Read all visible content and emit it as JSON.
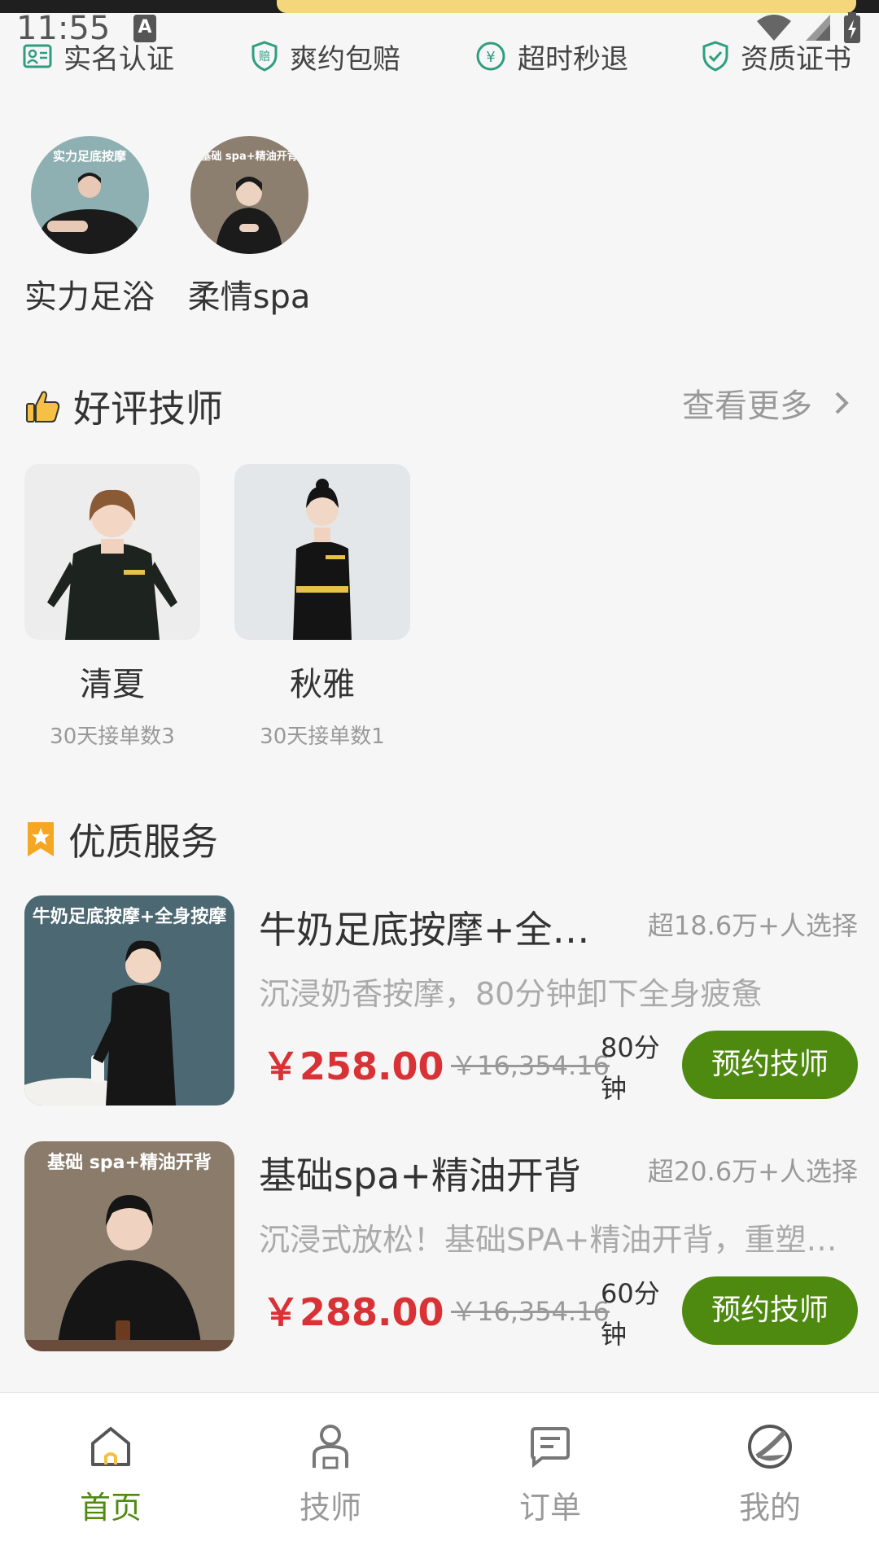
{
  "status_bar": {
    "time": "11:55",
    "notification_letter": "A"
  },
  "guarantees": [
    {
      "label": "实名认证",
      "icon": "id-card-icon"
    },
    {
      "label": "爽约包赔",
      "icon": "shield-compensation-icon",
      "badge": "赔"
    },
    {
      "label": "超时秒退",
      "icon": "yen-refund-icon",
      "badge": "¥"
    },
    {
      "label": "资质证书",
      "icon": "shield-check-icon"
    }
  ],
  "categories": [
    {
      "label": "实力足浴",
      "thumb_caption": "实力足底按摩"
    },
    {
      "label": "柔情spa",
      "thumb_caption": "基础 spa+精油开背"
    }
  ],
  "good_reviews": {
    "title": "好评技师",
    "more_label": "查看更多",
    "technicians": [
      {
        "name": "清夏",
        "orders": "30天接单数3"
      },
      {
        "name": "秋雅",
        "orders": "30天接单数1"
      }
    ]
  },
  "quality_services": {
    "title": "优质服务",
    "items": [
      {
        "thumb_caption": "牛奶足底按摩+全身按摩",
        "name": "牛奶足底按摩+全身按摩",
        "chosen": "超18.6万+人选择",
        "desc": "沉浸奶香按摩，80分钟卸下全身疲惫",
        "price": "￥258.00",
        "original_price": "￥16,354.16",
        "duration": "80分钟",
        "book_label": "预约技师"
      },
      {
        "thumb_caption": "基础 spa+精油开背",
        "name": "基础spa+精油开背",
        "chosen": "超20.6万+人选择",
        "desc": "沉浸式放松！基础SPA+精油开背，重塑身心活力",
        "price": "￥288.00",
        "original_price": "￥16,354.16",
        "duration": "60分钟",
        "book_label": "预约技师"
      }
    ]
  },
  "bottom_nav": [
    {
      "label": "首页",
      "icon": "home-icon",
      "active": true
    },
    {
      "label": "技师",
      "icon": "technician-icon",
      "active": false
    },
    {
      "label": "订单",
      "icon": "order-icon",
      "active": false
    },
    {
      "label": "我的",
      "icon": "profile-icon",
      "active": false
    }
  ],
  "colors": {
    "accent": "#4f8a10",
    "price": "#d93236",
    "guarantee_icon": "#2e9e7e",
    "star": "#f5a623"
  }
}
